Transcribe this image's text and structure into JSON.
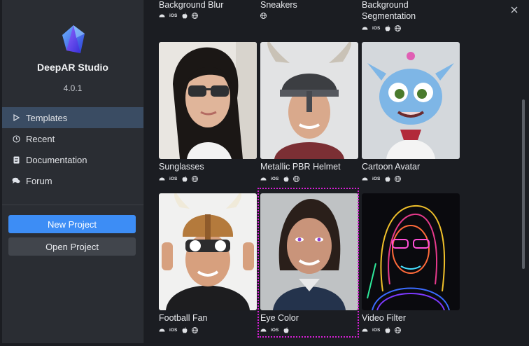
{
  "app": {
    "name": "DeepAR Studio",
    "version": "4.0.1"
  },
  "nav": [
    {
      "label": "Templates",
      "icon": "play-outline-icon",
      "active": true
    },
    {
      "label": "Recent",
      "icon": "clock-icon"
    },
    {
      "label": "Documentation",
      "icon": "document-icon"
    },
    {
      "label": "Forum",
      "icon": "chat-bubbles-icon"
    }
  ],
  "buttons": {
    "new_project": "New Project",
    "open_project": "Open Project"
  },
  "colors": {
    "accent": "#3d8df5",
    "active_nav": "#3a4c63",
    "selection": "#d81fd6"
  },
  "templates": [
    {
      "title": "Background Blur",
      "platforms": [
        "android",
        "ios",
        "apple",
        "web"
      ]
    },
    {
      "title": "Sneakers",
      "platforms": [
        "web"
      ]
    },
    {
      "title": "Background",
      "title_line2": "Segmentation",
      "platforms": [
        "android",
        "ios",
        "apple",
        "web"
      ]
    },
    {
      "title": "Sunglasses",
      "platforms": [
        "android",
        "ios",
        "apple",
        "web"
      ]
    },
    {
      "title": "Metallic PBR Helmet",
      "platforms": [
        "android",
        "ios",
        "apple",
        "web"
      ]
    },
    {
      "title": "Cartoon Avatar",
      "platforms": [
        "android",
        "ios",
        "apple",
        "web"
      ]
    },
    {
      "title": "Football Fan",
      "platforms": [
        "android",
        "ios",
        "apple",
        "web"
      ]
    },
    {
      "title": "Eye Color",
      "platforms": [
        "android",
        "ios",
        "apple"
      ],
      "selected": true
    },
    {
      "title": "Video Filter",
      "platforms": [
        "android",
        "ios",
        "apple",
        "web"
      ]
    }
  ],
  "platform_labels": {
    "ios": "iOS"
  }
}
